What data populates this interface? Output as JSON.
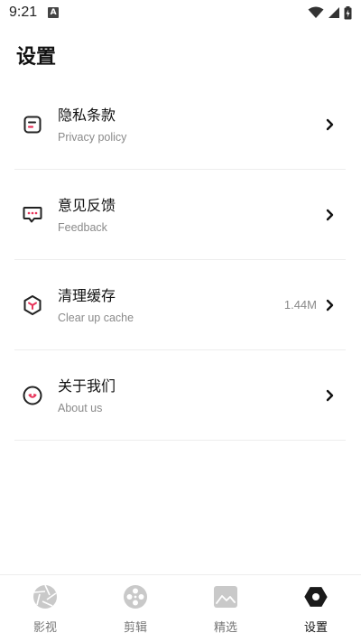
{
  "status_bar": {
    "time": "9:21",
    "notification_badge": "A"
  },
  "page": {
    "title": "设置"
  },
  "settings": [
    {
      "icon": "document-icon",
      "title": "隐私条款",
      "subtitle": "Privacy policy",
      "value": ""
    },
    {
      "icon": "chat-bubble-icon",
      "title": "意见反馈",
      "subtitle": "Feedback",
      "value": ""
    },
    {
      "icon": "cube-icon",
      "title": "清理缓存",
      "subtitle": "Clear up cache",
      "value": "1.44M"
    },
    {
      "icon": "smile-icon",
      "title": "关于我们",
      "subtitle": "About us",
      "value": ""
    }
  ],
  "bottom_nav": [
    {
      "icon": "aperture-icon",
      "label": "影视",
      "active": false
    },
    {
      "icon": "film-reel-icon",
      "label": "剪辑",
      "active": false
    },
    {
      "icon": "image-icon",
      "label": "精选",
      "active": false
    },
    {
      "icon": "hexagon-settings-icon",
      "label": "设置",
      "active": true
    }
  ],
  "colors": {
    "accent": "#e8345a",
    "text": "#111111",
    "muted": "#8a8a8a"
  }
}
